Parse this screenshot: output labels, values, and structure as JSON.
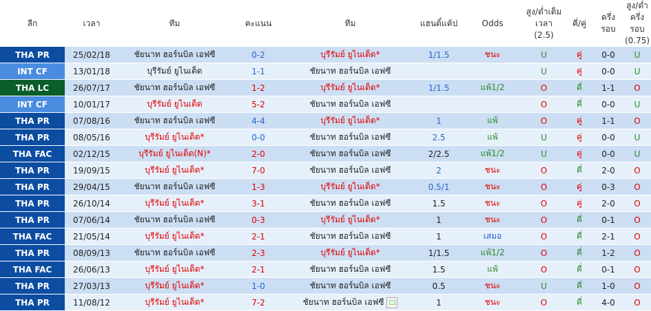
{
  "headers": {
    "league": "ลีก",
    "time": "เวลา",
    "home": "ทีม",
    "score": "คะแนน",
    "away": "ทีม",
    "handicap": "แฮนดิ์แค้ป",
    "odds": "Odds",
    "ou_line1": "สูง/ต่ำเต็ม",
    "ou_line2": "เวลา",
    "ou_line3": "(2.5)",
    "oddeven": "คี่/คู่",
    "half_line1": "ครึ่ง",
    "half_line2": "รอบ",
    "ouh_line1": "สูง/ต่ำครึ่ง",
    "ouh_line2": "รอบ",
    "ouh_line3": "(0.75)"
  },
  "colors": {
    "league_blue": "#0c4da2",
    "league_light": "#4a8ce0",
    "league_green": "#0b5d2b",
    "red": "#e00000",
    "blue": "#2266cc",
    "green": "#2a8a2a"
  },
  "rows": [
    {
      "league": "THA PR",
      "date": "25/02/18",
      "home": "ชัยนาท ฮอร์นบิล เอฟซี",
      "score": "0-2",
      "away": "บุรีรัมย์ ยูไนเต็ด*",
      "hcap": "1/1.5",
      "odds": "ชนะ",
      "ou": "U",
      "oe": "คู่",
      "half": "0-0",
      "ouh": "U"
    },
    {
      "league": "INT CF",
      "date": "13/01/18",
      "home": "บุรีรัมย์ ยูไนเต็ด",
      "score": "1-1",
      "away": "ชัยนาท ฮอร์นบิล เอฟซี",
      "hcap": "",
      "odds": "",
      "ou": "U",
      "oe": "คู่",
      "half": "0-0",
      "ouh": "U"
    },
    {
      "league": "THA LC",
      "date": "26/07/17",
      "home": "ชัยนาท ฮอร์นบิล เอฟซี",
      "score": "1-2",
      "away": "บุรีรัมย์ ยูไนเต็ด*",
      "hcap": "1/1.5",
      "odds": "แพ้1/2",
      "ou": "O",
      "oe": "คี่",
      "half": "1-1",
      "ouh": "O"
    },
    {
      "league": "INT CF",
      "date": "10/01/17",
      "home": "บุรีรัมย์ ยูไนเต็ด",
      "score": "5-2",
      "away": "ชัยนาท ฮอร์นบิล เอฟซี",
      "hcap": "",
      "odds": "",
      "ou": "O",
      "oe": "คี่",
      "half": "0-0",
      "ouh": "U"
    },
    {
      "league": "THA PR",
      "date": "07/08/16",
      "home": "ชัยนาท ฮอร์นบิล เอฟซี",
      "score": "4-4",
      "away": "บุรีรัมย์ ยูไนเต็ด*",
      "hcap": "1",
      "odds": "แพ้",
      "ou": "O",
      "oe": "คู่",
      "half": "1-1",
      "ouh": "O"
    },
    {
      "league": "THA PR",
      "date": "08/05/16",
      "home": "บุรีรัมย์ ยูไนเต็ด*",
      "score": "0-0",
      "away": "ชัยนาท ฮอร์นบิล เอฟซี",
      "hcap": "2.5",
      "odds": "แพ้",
      "ou": "U",
      "oe": "คู่",
      "half": "0-0",
      "ouh": "U"
    },
    {
      "league": "THA FAC",
      "date": "02/12/15",
      "home": "บุรีรัมย์ ยูไนเต็ด(N)*",
      "score": "2-0",
      "away": "ชัยนาท ฮอร์นบิล เอฟซี",
      "hcap": "2/2.5",
      "odds": "แพ้1/2",
      "ou": "U",
      "oe": "คู่",
      "half": "0-0",
      "ouh": "U"
    },
    {
      "league": "THA PR",
      "date": "19/09/15",
      "home": "บุรีรัมย์ ยูไนเต็ด*",
      "score": "7-0",
      "away": "ชัยนาท ฮอร์นบิล เอฟซี",
      "hcap": "2",
      "odds": "ชนะ",
      "ou": "O",
      "oe": "คี่",
      "half": "2-0",
      "ouh": "O"
    },
    {
      "league": "THA PR",
      "date": "29/04/15",
      "home": "ชัยนาท ฮอร์นบิล เอฟซี",
      "score": "1-3",
      "away": "บุรีรัมย์ ยูไนเต็ด*",
      "hcap": "0.5/1",
      "odds": "ชนะ",
      "ou": "O",
      "oe": "คู่",
      "half": "0-3",
      "ouh": "O"
    },
    {
      "league": "THA PR",
      "date": "26/10/14",
      "home": "บุรีรัมย์ ยูไนเต็ด*",
      "score": "3-1",
      "away": "ชัยนาท ฮอร์นบิล เอฟซี",
      "hcap": "1.5",
      "odds": "ชนะ",
      "ou": "O",
      "oe": "คู่",
      "half": "2-0",
      "ouh": "O"
    },
    {
      "league": "THA PR",
      "date": "07/06/14",
      "home": "ชัยนาท ฮอร์นบิล เอฟซี",
      "score": "0-3",
      "away": "บุรีรัมย์ ยูไนเต็ด*",
      "hcap": "1",
      "odds": "ชนะ",
      "ou": "O",
      "oe": "คี่",
      "half": "0-1",
      "ouh": "O"
    },
    {
      "league": "THA FAC",
      "date": "21/05/14",
      "home": "บุรีรัมย์ ยูไนเต็ด*",
      "score": "2-1",
      "away": "ชัยนาท ฮอร์นบิล เอฟซี",
      "hcap": "1",
      "odds": "เสมอ",
      "ou": "O",
      "oe": "คี่",
      "half": "2-1",
      "ouh": "O"
    },
    {
      "league": "THA PR",
      "date": "08/09/13",
      "home": "ชัยนาท ฮอร์นบิล เอฟซี",
      "score": "2-3",
      "away": "บุรีรัมย์ ยูไนเต็ด*",
      "hcap": "1/1.5",
      "odds": "แพ้1/2",
      "ou": "O",
      "oe": "คี่",
      "half": "1-2",
      "ouh": "O"
    },
    {
      "league": "THA FAC",
      "date": "26/06/13",
      "home": "บุรีรัมย์ ยูไนเต็ด*",
      "score": "2-1",
      "away": "ชัยนาท ฮอร์นบิล เอฟซี",
      "hcap": "1.5",
      "odds": "แพ้",
      "ou": "O",
      "oe": "คี่",
      "half": "0-1",
      "ouh": "O"
    },
    {
      "league": "THA PR",
      "date": "27/03/13",
      "home": "บุรีรัมย์ ยูไนเต็ด*",
      "score": "1-0",
      "away": "ชัยนาท ฮอร์นบิล เอฟซี",
      "hcap": "0.5",
      "odds": "ชนะ",
      "ou": "U",
      "oe": "คี่",
      "half": "1-0",
      "ouh": "O"
    },
    {
      "league": "THA PR",
      "date": "11/08/12",
      "home": "บุรีรัมย์ ยูไนเต็ด*",
      "score": "7-2",
      "away": "ชัยนาท ฮอร์นบิล เอฟซี",
      "hcap": "1",
      "odds": "ชนะ",
      "ou": "O",
      "oe": "คี่",
      "half": "4-0",
      "ouh": "O"
    }
  ]
}
